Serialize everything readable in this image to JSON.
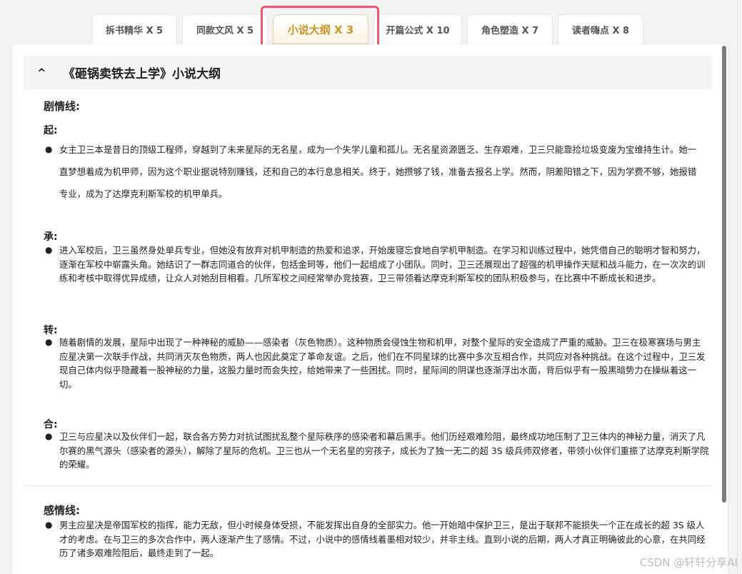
{
  "tabs": [
    {
      "label": "拆书精华 X 5"
    },
    {
      "label": "同款文风 X 5"
    },
    {
      "label": "小说大纲 X 3"
    },
    {
      "label": "开篇公式 X 10"
    },
    {
      "label": "角色塑造 X 7"
    },
    {
      "label": "读者嗨点 X 8"
    }
  ],
  "outline": {
    "caret": "^",
    "title": "《砸锅卖铁去上学》小说大纲"
  },
  "plot": {
    "heading": "剧情线:",
    "sections": [
      {
        "title": "起:",
        "text": "女主卫三本是昔日的顶级工程师，穿越到了未来星际的无名星，成为一个失学儿童和孤儿。无名星资源匮乏、生存艰难，卫三只能靠捡垃圾变废为宝维持生计。她一直梦想着成为机甲师，因为这个职业据说特别赚钱，还和自己的本行息息相关。终于，她攒够了钱，准备去报名上学。然而，阴差阳错之下，因为学费不够，她报错专业，成为了达摩克利斯军校的机甲单兵。"
      },
      {
        "title": "承:",
        "text": "进入军校后，卫三虽然身处单兵专业，但她没有放弃对机甲制造的热爱和追求，开始废寝忘食地自学机甲制造。在学习和训练过程中，她凭借自己的聪明才智和努力，逐渐在军校中崭露头角。她结识了一群志同道合的伙伴，包括金珂等，他们一起组成了小团队。同时，卫三还展现出了超强的机甲操作天赋和战斗能力，在一次次的训练和考核中取得优异成绩，让众人对她刮目相看。几所军校之间经常举办竞技赛，卫三带领着达摩克利斯军校的团队积极参与，在比赛中不断成长和进步。"
      },
      {
        "title": "转:",
        "text": "随着剧情的发展，星际中出现了一种神秘的威胁——感染者（灰色物质）。这种物质会侵蚀生物和机甲，对整个星际的安全造成了严重的威胁。卫三在极寒赛场与男主应星决第一次联手作战，共同消灭灰色物质，两人也因此奠定了革命友谊。之后，他们在不同星球的比赛中多次互相合作，共同应对各种挑战。在这个过程中，卫三发现自己体内似乎隐藏着一股神秘的力量，这股力量时而会失控，给她带来了一些困扰。同时，星际间的阴谋也逐渐浮出水面，背后似乎有一股黑暗势力在操纵着这一切。"
      },
      {
        "title": "合:",
        "text": "卫三与应星决以及伙伴们一起，联合各方势力对抗试图扰乱整个星际秩序的感染者和幕后黑手。他们历经艰难险阻，最终成功地压制了卫三体内的神秘力量，消灭了凡尔赛的黑气源头（感染者的源头），解除了星际的危机。卫三也从一个无名星的穷孩子，成长为了独一无二的超 3S 级兵师双修者，带领小伙伴们重振了达摩克利斯学院的荣耀。"
      }
    ]
  },
  "romance": {
    "heading": "感情线:",
    "text": "男主应星决是帝国军校的指挥，能力无敌，但小时候身体受损，不能发挥出自身的全部实力。他一开始暗中保护卫三，是出于联邦不能损失一个正在成长的超 3S 级人才的考虑。在与卫三的多次合作中，两人逐渐产生了感情。不过，小说中的感情线着墨相对较少，并非主线。直到小说的后期，两人才真正明确彼此的心意，在共同经历了诸多艰难险阻后，最终走到了一起。"
  },
  "watermark": "CSDN @轩轩分享AI",
  "colors": {
    "active_tab_text": "#c8952b",
    "highlight_border": "#f0566d"
  }
}
